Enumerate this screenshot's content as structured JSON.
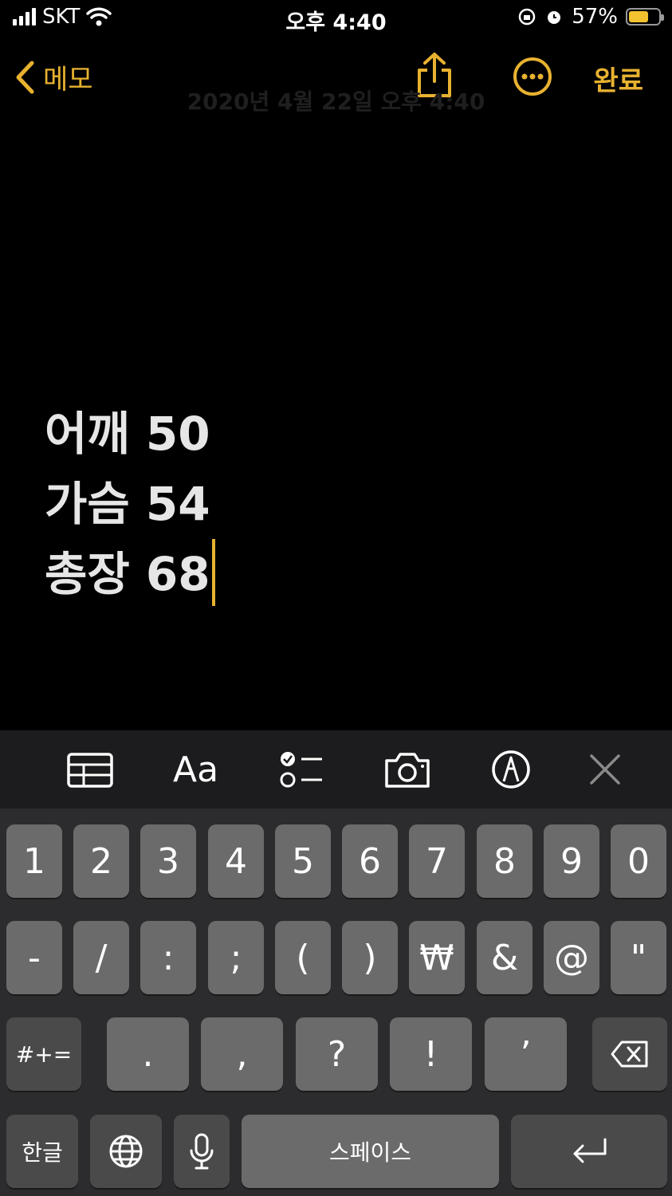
{
  "status_bar": {
    "carrier": "SKT",
    "time": "오후 4:40",
    "battery": "57%"
  },
  "nav": {
    "back_label": "메모",
    "done_label": "완료",
    "date": "2020년 4월 22일 오후 4:40"
  },
  "note": {
    "lines": [
      "어깨 50",
      "가슴 54",
      "총장 68"
    ]
  },
  "toolbar": {
    "format_label": "Aa"
  },
  "keyboard": {
    "row1": [
      "1",
      "2",
      "3",
      "4",
      "5",
      "6",
      "7",
      "8",
      "9",
      "0"
    ],
    "row2": [
      "-",
      "/",
      ":",
      ";",
      "(",
      ")",
      "₩",
      "&",
      "@",
      "\""
    ],
    "row3": [
      "#+=",
      ".",
      ",",
      "?",
      "!",
      "’"
    ],
    "row4": {
      "lang": "한글",
      "space": "스페이스"
    }
  },
  "colors": {
    "accent": "#e8b230",
    "background": "#000000",
    "key": "#6b6b6b"
  }
}
